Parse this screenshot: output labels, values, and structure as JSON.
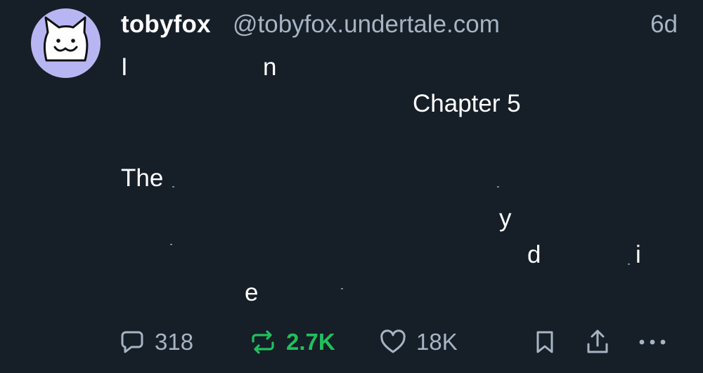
{
  "post": {
    "author": {
      "display_name": "tobyfox",
      "handle": "@tobyfox.undertale.com",
      "avatar_icon": "white-dog-face-icon"
    },
    "timestamp": "6d",
    "text_fragments": [
      "I",
      "n",
      "Chapter 5",
      "The",
      "y",
      "d",
      "i",
      "e"
    ]
  },
  "actions": {
    "reply": {
      "icon": "speech-bubble-icon",
      "count": "318"
    },
    "repost": {
      "icon": "repost-arrows-icon",
      "count": "2.7K",
      "active_color": "#20c05c"
    },
    "like": {
      "icon": "heart-icon",
      "count": "18K"
    },
    "bookmark": {
      "icon": "bookmark-icon"
    },
    "share": {
      "icon": "share-upload-icon"
    },
    "more": {
      "icon": "more-dots-icon"
    }
  },
  "colors": {
    "background": "#161e27",
    "text": "#ffffff",
    "muted": "#a6b4c4",
    "avatar_bg": "#b8b6f2",
    "repost_active": "#20c05c"
  }
}
